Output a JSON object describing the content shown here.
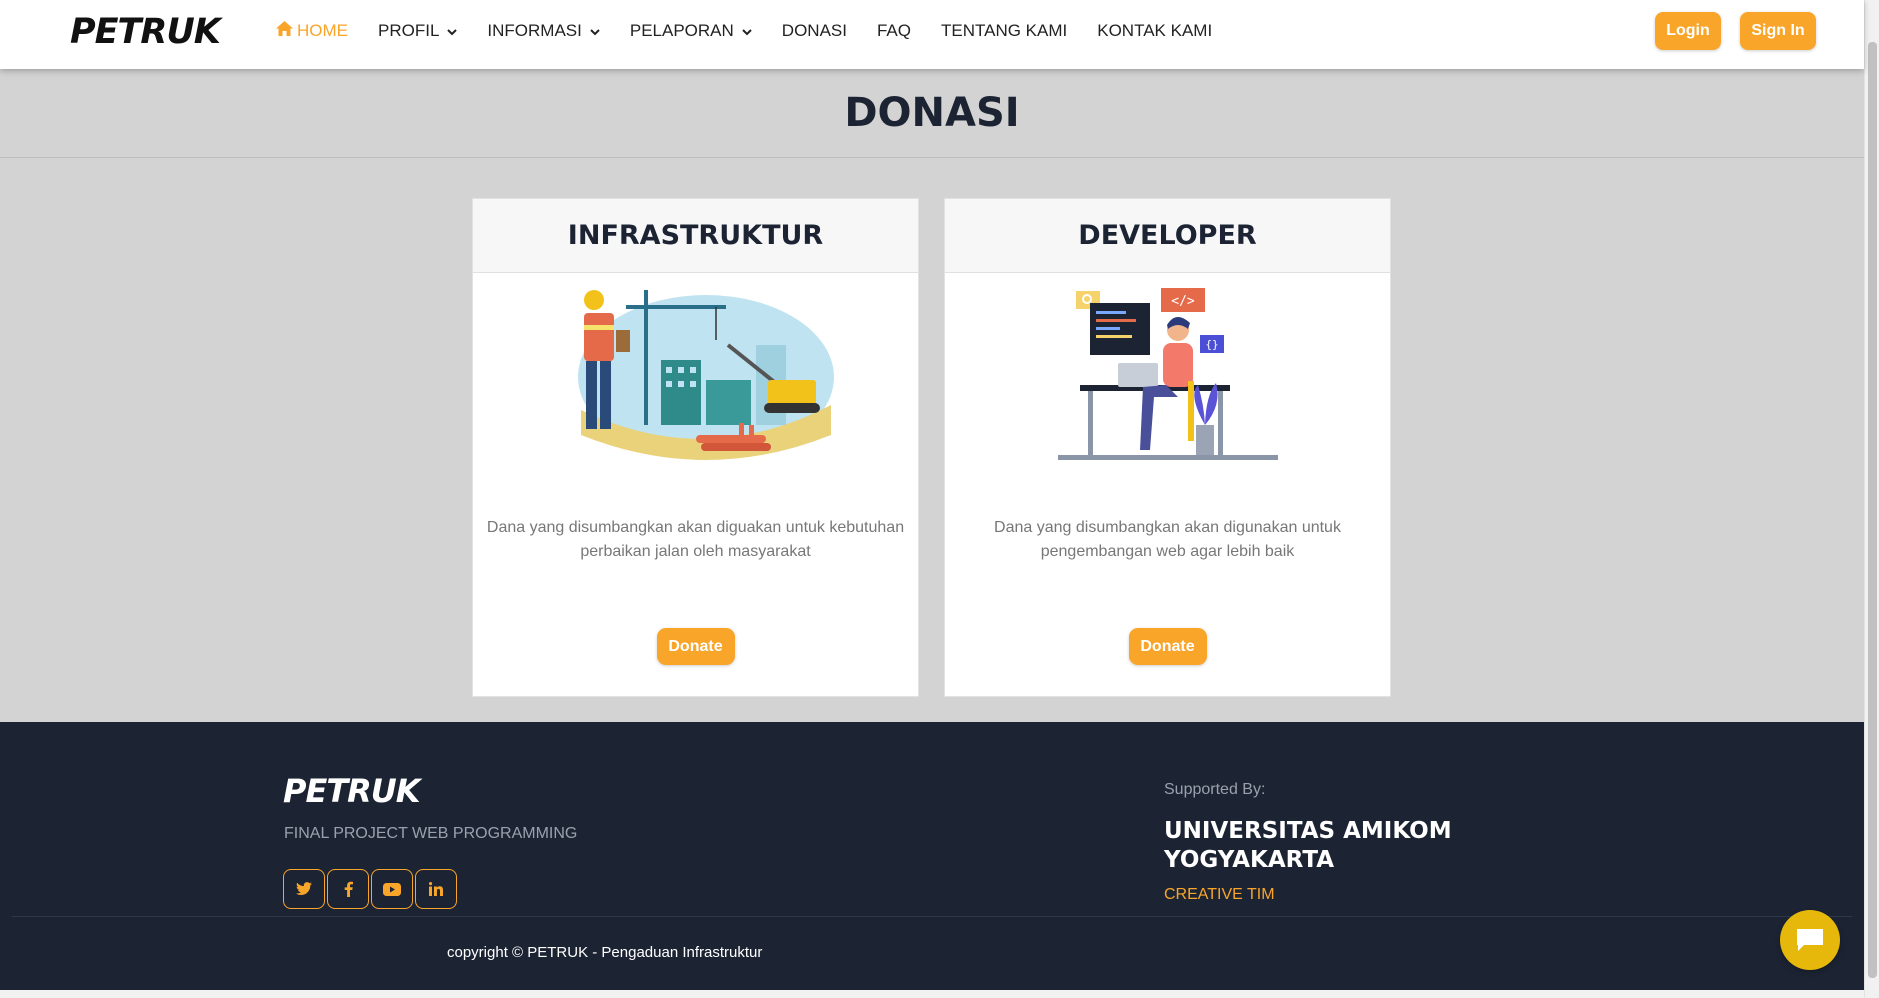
{
  "brand": "PETRUK",
  "nav": {
    "items": [
      {
        "label": "HOME",
        "active": true,
        "dropdown": false,
        "icon": "home-icon"
      },
      {
        "label": "PROFIL",
        "active": false,
        "dropdown": true
      },
      {
        "label": "INFORMASI",
        "active": false,
        "dropdown": true
      },
      {
        "label": "PELAPORAN",
        "active": false,
        "dropdown": true
      },
      {
        "label": "DONASI",
        "active": false,
        "dropdown": false
      },
      {
        "label": "FAQ",
        "active": false,
        "dropdown": false
      },
      {
        "label": "TENTANG KAMI",
        "active": false,
        "dropdown": false
      },
      {
        "label": "KONTAK KAMI",
        "active": false,
        "dropdown": false
      }
    ],
    "login_label": "Login",
    "signin_label": "Sign In"
  },
  "page": {
    "title": "DONASI"
  },
  "cards": [
    {
      "title": "INFRASTRUKTUR",
      "description": "Dana yang disumbangkan akan diguakan untuk kebutuhan perbaikan jalan oleh masyarakat",
      "button_label": "Donate",
      "illustration": "construction-illustration"
    },
    {
      "title": "DEVELOPER",
      "description": "Dana yang disumbangkan akan digunakan untuk pengembangan web agar lebih baik",
      "button_label": "Donate",
      "illustration": "developer-illustration"
    }
  ],
  "footer": {
    "brand": "PETRUK",
    "tagline": "FINAL PROJECT WEB PROGRAMMING",
    "socials": [
      "twitter-icon",
      "facebook-icon",
      "youtube-icon",
      "linkedin-icon"
    ],
    "supported_by": "Supported By:",
    "university": "UNIVERSITAS AMIKOM YOGYAKARTA",
    "creative": "CREATIVE TIM",
    "copyright": "copyright © PETRUK - Pengaduan Infrastruktur"
  },
  "colors": {
    "accent": "#f9a529",
    "navy": "#1c2434",
    "page_bg": "#d3d3d3",
    "chat": "#e6b80c"
  }
}
